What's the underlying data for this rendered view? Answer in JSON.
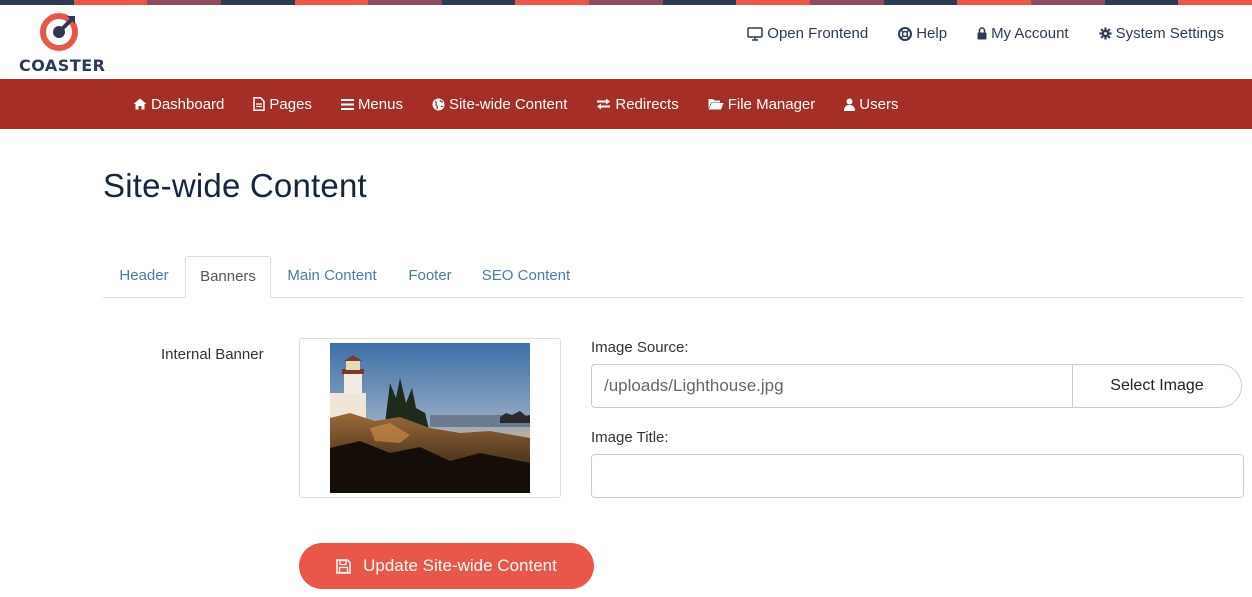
{
  "brand": {
    "name": "COASTER",
    "stripe_colors": [
      "#2c3b55",
      "#e8574a",
      "#8e4a5e",
      "#2c3b55",
      "#e8574a",
      "#8e4a5e",
      "#2c3b55",
      "#e8574a",
      "#8e4a5e",
      "#2c3b55",
      "#e8574a",
      "#8e4a5e",
      "#2c3b55",
      "#e8574a",
      "#8e4a5e",
      "#2c3b55",
      "#e8574a"
    ]
  },
  "utility_nav": [
    {
      "label": "Open Frontend",
      "icon": "monitor-icon"
    },
    {
      "label": "Help",
      "icon": "lifebuoy-icon"
    },
    {
      "label": "My Account",
      "icon": "lock-icon"
    },
    {
      "label": "System Settings",
      "icon": "gear-icon"
    }
  ],
  "main_nav": [
    {
      "label": "Dashboard",
      "icon": "home-icon"
    },
    {
      "label": "Pages",
      "icon": "file-icon"
    },
    {
      "label": "Menus",
      "icon": "bars-icon"
    },
    {
      "label": "Site-wide Content",
      "icon": "globe-icon"
    },
    {
      "label": "Redirects",
      "icon": "exchange-icon"
    },
    {
      "label": "File Manager",
      "icon": "folder-open-icon"
    },
    {
      "label": "Users",
      "icon": "user-icon"
    }
  ],
  "page": {
    "title": "Site-wide Content"
  },
  "tabs": [
    {
      "label": "Header",
      "active": false
    },
    {
      "label": "Banners",
      "active": true
    },
    {
      "label": "Main Content",
      "active": false
    },
    {
      "label": "Footer",
      "active": false
    },
    {
      "label": "SEO Content",
      "active": false
    }
  ],
  "banner": {
    "label": "Internal Banner",
    "image_source_label": "Image Source:",
    "image_source_value": "/uploads/Lighthouse.jpg",
    "select_image_label": "Select Image",
    "image_title_label": "Image Title:",
    "image_title_value": ""
  },
  "actions": {
    "update_label": "Update Site-wide Content",
    "update_icon": "floppy-disk-icon"
  },
  "colors": {
    "nav_bar": "#a52e27",
    "accent": "#e8574a",
    "dark_navy": "#2c3b55",
    "link": "#4a7ba6"
  }
}
